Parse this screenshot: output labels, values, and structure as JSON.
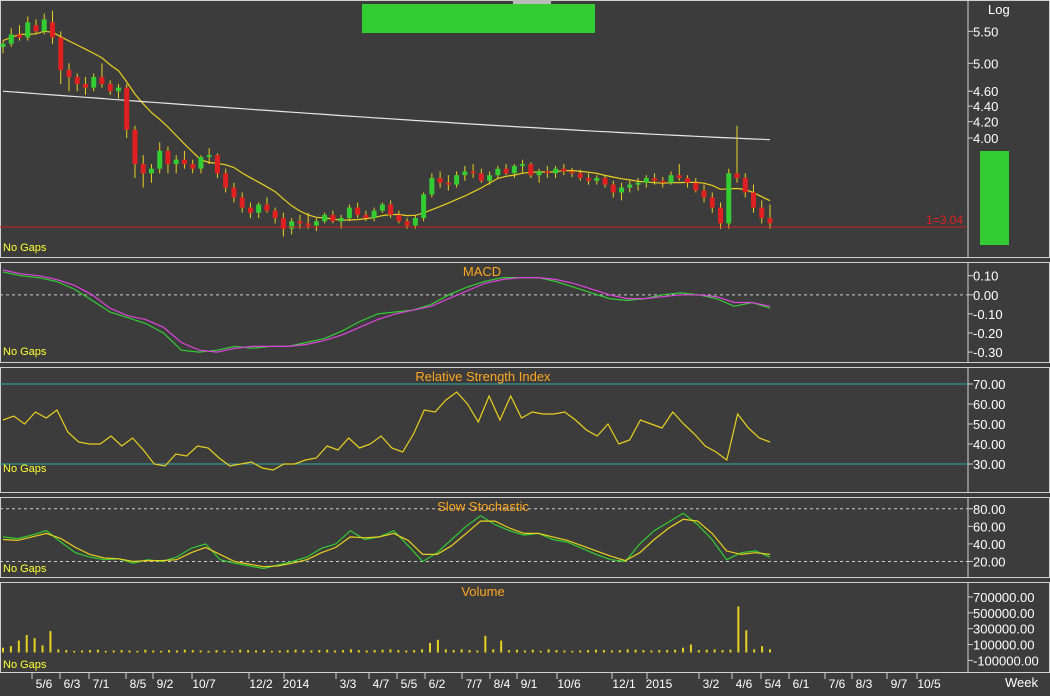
{
  "colors": {
    "background": "#3c3c3c",
    "up": "#33cc33",
    "down": "#e02020",
    "ma_short": "#e8d020",
    "ma_long": "#e6e6e6",
    "macd_line": "#33cc33",
    "macd_signal": "#dd44dd",
    "rsi_line": "#e8d020",
    "stoch_k": "#33cc33",
    "stoch_d": "#e8d020",
    "volume": "#e8d020",
    "ref_line": "#33aaaa"
  },
  "price_panel": {
    "scale_mode": "Log",
    "last_label": "1=3.04",
    "no_gaps": "No Gaps"
  },
  "macd": {
    "title": "MACD",
    "no_gaps": "No Gaps"
  },
  "rsi": {
    "title": "Relative Strength Index",
    "no_gaps": "No Gaps"
  },
  "stochastic": {
    "title": "Slow Stochastic",
    "no_gaps": "No Gaps"
  },
  "volume": {
    "title": "Volume",
    "no_gaps": "No Gaps"
  },
  "date_axis": {
    "period": "Week"
  },
  "chart_data": [
    {
      "type": "candlestick",
      "title": "",
      "scale": "log",
      "y_ticks": [
        "5.50",
        "5.00",
        "4.60",
        "4.40",
        "4.20",
        "4.00"
      ],
      "y_tick_values": [
        5.5,
        5.0,
        4.6,
        4.4,
        4.2,
        4.0
      ],
      "last_price": 3.04,
      "ohlc": [
        [
          5.25,
          5.35,
          5.15,
          5.3
        ],
        [
          5.3,
          5.55,
          5.25,
          5.45
        ],
        [
          5.45,
          5.6,
          5.35,
          5.4
        ],
        [
          5.4,
          5.75,
          5.35,
          5.65
        ],
        [
          5.6,
          5.7,
          5.45,
          5.5
        ],
        [
          5.5,
          5.8,
          5.45,
          5.7
        ],
        [
          5.65,
          5.85,
          5.3,
          5.4
        ],
        [
          5.4,
          5.5,
          4.7,
          4.9
        ],
        [
          4.9,
          5.0,
          4.6,
          4.8
        ],
        [
          4.8,
          4.85,
          4.6,
          4.7
        ],
        [
          4.7,
          4.8,
          4.55,
          4.65
        ],
        [
          4.65,
          4.85,
          4.6,
          4.8
        ],
        [
          4.8,
          5.0,
          4.65,
          4.7
        ],
        [
          4.7,
          4.75,
          4.55,
          4.6
        ],
        [
          4.6,
          4.7,
          4.5,
          4.65
        ],
        [
          4.65,
          4.7,
          4.0,
          4.1
        ],
        [
          4.1,
          4.15,
          3.55,
          3.7
        ],
        [
          3.7,
          3.8,
          3.45,
          3.6
        ],
        [
          3.6,
          3.7,
          3.5,
          3.65
        ],
        [
          3.65,
          3.95,
          3.6,
          3.85
        ],
        [
          3.85,
          3.9,
          3.6,
          3.7
        ],
        [
          3.7,
          3.8,
          3.6,
          3.75
        ],
        [
          3.75,
          3.85,
          3.65,
          3.7
        ],
        [
          3.7,
          3.75,
          3.6,
          3.65
        ],
        [
          3.65,
          3.8,
          3.6,
          3.78
        ],
        [
          3.78,
          3.88,
          3.7,
          3.8
        ],
        [
          3.8,
          3.82,
          3.55,
          3.6
        ],
        [
          3.6,
          3.65,
          3.4,
          3.45
        ],
        [
          3.45,
          3.5,
          3.3,
          3.35
        ],
        [
          3.35,
          3.4,
          3.2,
          3.25
        ],
        [
          3.25,
          3.3,
          3.15,
          3.2
        ],
        [
          3.2,
          3.3,
          3.15,
          3.28
        ],
        [
          3.28,
          3.35,
          3.2,
          3.22
        ],
        [
          3.22,
          3.25,
          3.1,
          3.15
        ],
        [
          3.15,
          3.2,
          2.98,
          3.05
        ],
        [
          3.05,
          3.15,
          3.0,
          3.12
        ],
        [
          3.12,
          3.18,
          3.05,
          3.1
        ],
        [
          3.1,
          3.2,
          3.05,
          3.08
        ],
        [
          3.08,
          3.15,
          3.03,
          3.12
        ],
        [
          3.12,
          3.2,
          3.1,
          3.18
        ],
        [
          3.18,
          3.22,
          3.1,
          3.12
        ],
        [
          3.12,
          3.18,
          3.05,
          3.15
        ],
        [
          3.15,
          3.28,
          3.12,
          3.25
        ],
        [
          3.25,
          3.3,
          3.15,
          3.18
        ],
        [
          3.18,
          3.22,
          3.12,
          3.15
        ],
        [
          3.15,
          3.25,
          3.12,
          3.22
        ],
        [
          3.22,
          3.3,
          3.2,
          3.28
        ],
        [
          3.28,
          3.32,
          3.15,
          3.18
        ],
        [
          3.18,
          3.22,
          3.1,
          3.12
        ],
        [
          3.12,
          3.15,
          3.05,
          3.08
        ],
        [
          3.08,
          3.18,
          3.05,
          3.15
        ],
        [
          3.15,
          3.4,
          3.12,
          3.38
        ],
        [
          3.38,
          3.6,
          3.35,
          3.55
        ],
        [
          3.55,
          3.62,
          3.45,
          3.5
        ],
        [
          3.5,
          3.58,
          3.42,
          3.48
        ],
        [
          3.48,
          3.62,
          3.45,
          3.58
        ],
        [
          3.58,
          3.68,
          3.52,
          3.62
        ],
        [
          3.62,
          3.7,
          3.55,
          3.6
        ],
        [
          3.6,
          3.65,
          3.5,
          3.52
        ],
        [
          3.52,
          3.62,
          3.48,
          3.58
        ],
        [
          3.58,
          3.68,
          3.55,
          3.65
        ],
        [
          3.65,
          3.7,
          3.58,
          3.6
        ],
        [
          3.6,
          3.7,
          3.55,
          3.68
        ],
        [
          3.68,
          3.75,
          3.6,
          3.7
        ],
        [
          3.7,
          3.72,
          3.55,
          3.58
        ],
        [
          3.58,
          3.65,
          3.5,
          3.62
        ],
        [
          3.62,
          3.68,
          3.55,
          3.6
        ],
        [
          3.6,
          3.68,
          3.55,
          3.65
        ],
        [
          3.65,
          3.7,
          3.58,
          3.62
        ],
        [
          3.62,
          3.66,
          3.56,
          3.6
        ],
        [
          3.6,
          3.64,
          3.52,
          3.55
        ],
        [
          3.55,
          3.6,
          3.48,
          3.52
        ],
        [
          3.52,
          3.58,
          3.48,
          3.55
        ],
        [
          3.55,
          3.58,
          3.45,
          3.48
        ],
        [
          3.48,
          3.52,
          3.35,
          3.4
        ],
        [
          3.4,
          3.5,
          3.32,
          3.45
        ],
        [
          3.45,
          3.52,
          3.4,
          3.48
        ],
        [
          3.48,
          3.55,
          3.42,
          3.5
        ],
        [
          3.5,
          3.58,
          3.45,
          3.55
        ],
        [
          3.55,
          3.6,
          3.48,
          3.52
        ],
        [
          3.52,
          3.56,
          3.45,
          3.5
        ],
        [
          3.5,
          3.62,
          3.48,
          3.58
        ],
        [
          3.58,
          3.7,
          3.52,
          3.55
        ],
        [
          3.55,
          3.58,
          3.45,
          3.5
        ],
        [
          3.5,
          3.55,
          3.4,
          3.42
        ],
        [
          3.42,
          3.48,
          3.3,
          3.35
        ],
        [
          3.35,
          3.4,
          3.2,
          3.25
        ],
        [
          3.25,
          3.3,
          3.05,
          3.1
        ],
        [
          3.1,
          3.65,
          3.05,
          3.6
        ],
        [
          3.6,
          4.15,
          3.5,
          3.55
        ],
        [
          3.55,
          3.6,
          3.35,
          3.4
        ],
        [
          3.4,
          3.48,
          3.2,
          3.25
        ],
        [
          3.25,
          3.32,
          3.1,
          3.15
        ],
        [
          3.15,
          3.28,
          3.05,
          3.1
        ]
      ]
    },
    {
      "type": "line",
      "title": "MACD",
      "y_ticks": [
        "0.10",
        "0.00",
        "-0.10",
        "-0.20",
        "-0.30"
      ],
      "y_tick_values": [
        0.1,
        0.0,
        -0.1,
        -0.2,
        -0.3
      ],
      "series": [
        {
          "values": [
            0.12,
            0.1,
            0.09,
            0.07,
            0.03,
            -0.03,
            -0.09,
            -0.12,
            -0.15,
            -0.2,
            -0.29,
            -0.3,
            -0.29,
            -0.27,
            -0.28,
            -0.27,
            -0.27,
            -0.25,
            -0.23,
            -0.19,
            -0.14,
            -0.1,
            -0.09,
            -0.08,
            -0.05,
            0.0,
            0.04,
            0.07,
            0.09,
            0.09,
            0.09,
            0.07,
            0.04,
            0.01,
            -0.02,
            -0.03,
            -0.02,
            0.0,
            0.01,
            0.0,
            -0.02,
            -0.06,
            -0.04,
            -0.07
          ]
        },
        {
          "values": [
            0.13,
            0.11,
            0.1,
            0.08,
            0.05,
            0.0,
            -0.07,
            -0.11,
            -0.13,
            -0.17,
            -0.25,
            -0.29,
            -0.3,
            -0.28,
            -0.27,
            -0.27,
            -0.27,
            -0.26,
            -0.24,
            -0.21,
            -0.17,
            -0.13,
            -0.1,
            -0.08,
            -0.06,
            -0.02,
            0.02,
            0.06,
            0.08,
            0.09,
            0.09,
            0.08,
            0.06,
            0.03,
            0.0,
            -0.02,
            -0.02,
            -0.01,
            0.0,
            0.0,
            -0.01,
            -0.04,
            -0.04,
            -0.06
          ]
        }
      ]
    },
    {
      "type": "line",
      "title": "Relative Strength Index",
      "y_ticks": [
        "70.00",
        "60.00",
        "50.00",
        "40.00",
        "30.00"
      ],
      "y_tick_values": [
        70,
        60,
        50,
        40,
        30
      ],
      "reference_levels": [
        70,
        30
      ],
      "values": [
        52,
        54,
        50,
        56,
        53,
        57,
        46,
        41,
        40,
        40,
        44,
        39,
        43,
        37,
        30,
        29,
        35,
        34,
        39,
        38,
        33,
        29,
        30,
        31,
        28,
        27,
        30,
        30,
        32,
        33,
        39,
        37,
        43,
        38,
        40,
        44,
        38,
        36,
        45,
        57,
        56,
        62,
        66,
        60,
        51,
        64,
        52,
        64,
        53,
        56,
        55,
        55,
        56,
        52,
        47,
        44,
        50,
        40,
        42,
        52,
        50,
        48,
        56,
        50,
        45,
        39,
        36,
        32,
        55,
        48,
        43,
        41
      ]
    },
    {
      "type": "line",
      "title": "Slow Stochastic",
      "y_ticks": [
        "80.00",
        "60.00",
        "40.00",
        "20.00"
      ],
      "y_tick_values": [
        80,
        60,
        40,
        20
      ],
      "reference_levels": [
        80,
        20
      ],
      "series": [
        {
          "values": [
            48,
            46,
            50,
            55,
            42,
            30,
            25,
            22,
            23,
            18,
            22,
            20,
            25,
            35,
            40,
            22,
            18,
            15,
            12,
            16,
            20,
            25,
            35,
            40,
            55,
            45,
            48,
            55,
            38,
            20,
            30,
            45,
            60,
            72,
            62,
            55,
            50,
            52,
            45,
            42,
            35,
            28,
            22,
            20,
            40,
            55,
            65,
            75,
            62,
            45,
            22,
            30,
            32,
            25
          ]
        },
        {
          "values": [
            45,
            44,
            48,
            52,
            46,
            36,
            28,
            24,
            23,
            20,
            21,
            21,
            22,
            30,
            36,
            28,
            20,
            17,
            14,
            15,
            18,
            22,
            30,
            36,
            48,
            47,
            48,
            52,
            44,
            28,
            28,
            38,
            52,
            66,
            66,
            58,
            52,
            52,
            48,
            44,
            38,
            32,
            26,
            21,
            30,
            45,
            58,
            68,
            66,
            52,
            32,
            28,
            30,
            28
          ]
        }
      ]
    },
    {
      "type": "bar",
      "title": "Volume",
      "y_ticks": [
        "700000.00",
        "500000.00",
        "300000.00",
        "100000.00",
        "-100000.00"
      ],
      "y_tick_values": [
        700000,
        500000,
        300000,
        100000,
        -100000
      ],
      "values": [
        60000,
        80000,
        150000,
        220000,
        180000,
        90000,
        270000,
        40000,
        30000,
        20000,
        25000,
        30000,
        35000,
        20000,
        25000,
        30000,
        25000,
        20000,
        35000,
        25000,
        20000,
        30000,
        25000,
        35000,
        30000,
        25000,
        20000,
        30000,
        25000,
        20000,
        35000,
        30000,
        25000,
        30000,
        20000,
        25000,
        30000,
        35000,
        30000,
        25000,
        30000,
        35000,
        25000,
        30000,
        40000,
        30000,
        25000,
        30000,
        35000,
        40000,
        30000,
        25000,
        30000,
        40000,
        120000,
        160000,
        40000,
        30000,
        40000,
        30000,
        25000,
        210000,
        40000,
        150000,
        30000,
        35000,
        25000,
        35000,
        20000,
        40000,
        30000,
        25000,
        20000,
        25000,
        30000,
        35000,
        30000,
        25000,
        30000,
        40000,
        35000,
        30000,
        25000,
        30000,
        30000,
        35000,
        60000,
        100000,
        30000,
        35000,
        40000,
        30000,
        35000,
        580000,
        280000,
        40000,
        80000,
        40000
      ]
    }
  ],
  "dates": [
    "5/6",
    "6/3",
    "7/1",
    "8/5",
    "9/2",
    "10/7",
    "12/2",
    "2014",
    "3/3",
    "4/7",
    "5/5",
    "6/2",
    "7/7",
    "8/4",
    "9/1",
    "10/6",
    "12/1",
    "2015",
    "3/2",
    "4/6",
    "5/4",
    "6/1",
    "7/6",
    "8/3",
    "9/7",
    "10/5"
  ]
}
